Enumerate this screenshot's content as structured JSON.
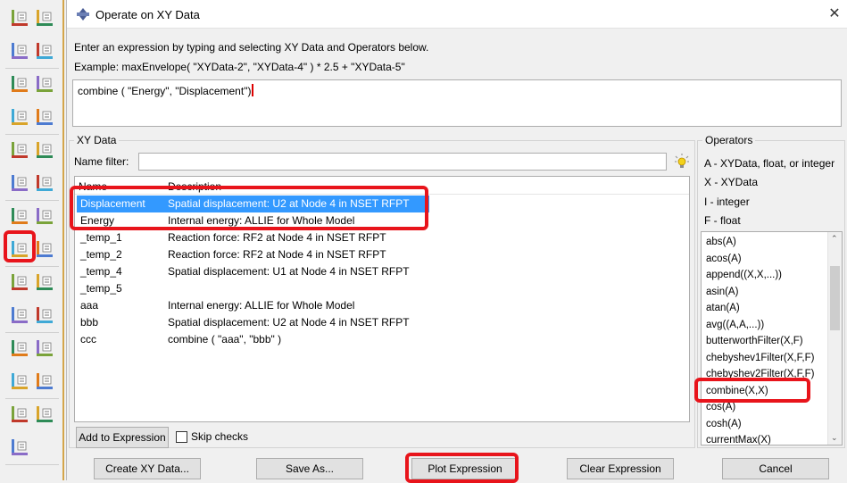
{
  "dialog": {
    "title": "Operate on XY Data",
    "close_glyph": "✕",
    "instruction": "Enter an expression by typing and selecting XY Data and Operators below.",
    "example": "Example: maxEnvelope( \"XYData-2\", \"XYData-4\" ) * 2.5 + \"XYData-5\"",
    "expression": "combine ( \"Energy\", \"Displacement\")"
  },
  "xy_data": {
    "group_title": "XY Data",
    "name_filter_label": "Name filter:",
    "name_filter_value": "",
    "columns": [
      "Name",
      "Description"
    ],
    "rows": [
      {
        "name": "Displacement",
        "description": "Spatial displacement: U2 at Node 4 in NSET RFPT",
        "selected": true
      },
      {
        "name": "Energy",
        "description": "Internal energy: ALLIE for Whole Model",
        "selected": false
      },
      {
        "name": "_temp_1",
        "description": "Reaction force: RF2 at Node 4 in NSET RFPT",
        "selected": false
      },
      {
        "name": "_temp_2",
        "description": "Reaction force: RF2 at Node 4 in NSET RFPT",
        "selected": false
      },
      {
        "name": "_temp_4",
        "description": "Spatial displacement: U1 at Node 4 in NSET RFPT",
        "selected": false
      },
      {
        "name": "_temp_5",
        "description": "",
        "selected": false
      },
      {
        "name": "aaa",
        "description": "Internal energy: ALLIE for Whole Model",
        "selected": false
      },
      {
        "name": "bbb",
        "description": "Spatial displacement: U2 at Node 4 in NSET RFPT",
        "selected": false
      },
      {
        "name": "ccc",
        "description": "combine ( \"aaa\", \"bbb\" )",
        "selected": false
      }
    ],
    "add_button": "Add to Expression",
    "skip_checks": "Skip checks"
  },
  "operators": {
    "group_title": "Operators",
    "legend": [
      "A - XYData, float, or integer",
      "X - XYData",
      "I - integer",
      "F - float"
    ],
    "items": [
      "abs(A)",
      "acos(A)",
      "append((X,X,...))",
      "asin(A)",
      "atan(A)",
      "avg((A,A,...))",
      "butterworthFilter(X,F)",
      "chebyshev1Filter(X,F,F)",
      "chebyshev2Filter(X,F,F)",
      "combine(X,X)",
      "cos(A)",
      "cosh(A)",
      "currentMax(X)"
    ]
  },
  "buttons": {
    "create": "Create XY Data...",
    "save_as": "Save As...",
    "plot": "Plot Expression",
    "clear": "Clear Expression",
    "cancel": "Cancel"
  },
  "icons": {
    "toolbar": [
      "bar-chart-icon",
      "line-chart-icon",
      "xy-plot-icon",
      "xy-plot-x-icon",
      "xy-plot-star-icon",
      "xy-plot-copy-icon",
      "animate-icon",
      "animate-time-icon",
      "results-icon",
      "results-list-icon",
      "node-icon",
      "report-icon",
      "operate-xy-icon",
      "table-icon",
      "path-icon",
      "line-plot-icon",
      "surface-icon",
      "mesh-icon",
      "color-legend-icon",
      "field-icon",
      "probe-icon",
      "list-icon",
      "sweep-icon",
      "section-icon",
      "view-cut-icon",
      "arrow-icon",
      "pen-icon"
    ],
    "title": "operate-xy-title-icon",
    "bulb": "lightbulb-icon"
  },
  "colors": {
    "selection": "#3399ff",
    "highlight": "#e8141b"
  }
}
